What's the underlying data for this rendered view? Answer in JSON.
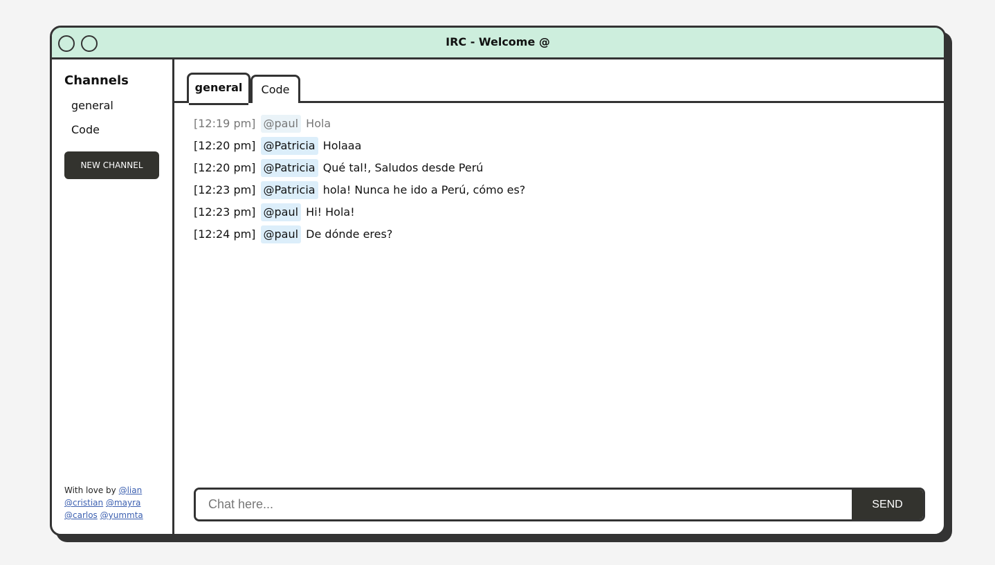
{
  "window": {
    "title": "IRC - Welcome @"
  },
  "sidebar": {
    "heading": "Channels",
    "channels": [
      {
        "label": "general"
      },
      {
        "label": "Code"
      }
    ],
    "new_channel_label": "NEW CHANNEL",
    "credits": {
      "prefix": "With love by",
      "authors": [
        "@lian",
        "@cristian",
        "@mayra",
        "@carlos",
        "@yummta"
      ]
    }
  },
  "tabs": [
    {
      "label": "general",
      "active": true
    },
    {
      "label": "Code",
      "active": false
    }
  ],
  "messages": [
    {
      "time": "[12:19 pm]",
      "user": "@paul",
      "text": "Hola"
    },
    {
      "time": "[12:20 pm]",
      "user": "@Patricia",
      "text": "Holaaa"
    },
    {
      "time": "[12:20 pm]",
      "user": "@Patricia",
      "text": "Qué tal!, Saludos desde Perú"
    },
    {
      "time": "[12:23 pm]",
      "user": "@Patricia",
      "text": "hola! Nunca he ido a Perú, cómo es?"
    },
    {
      "time": "[12:23 pm]",
      "user": "@paul",
      "text": "Hi! Hola!"
    },
    {
      "time": "[12:24 pm]",
      "user": "@paul",
      "text": "De dónde eres?"
    }
  ],
  "composer": {
    "placeholder": "Chat here...",
    "value": "",
    "send_label": "SEND"
  },
  "colors": {
    "titlebar": "#cdeedd",
    "dark": "#33332e",
    "user_tag": "#dceefa",
    "link": "#3b5fb0"
  }
}
